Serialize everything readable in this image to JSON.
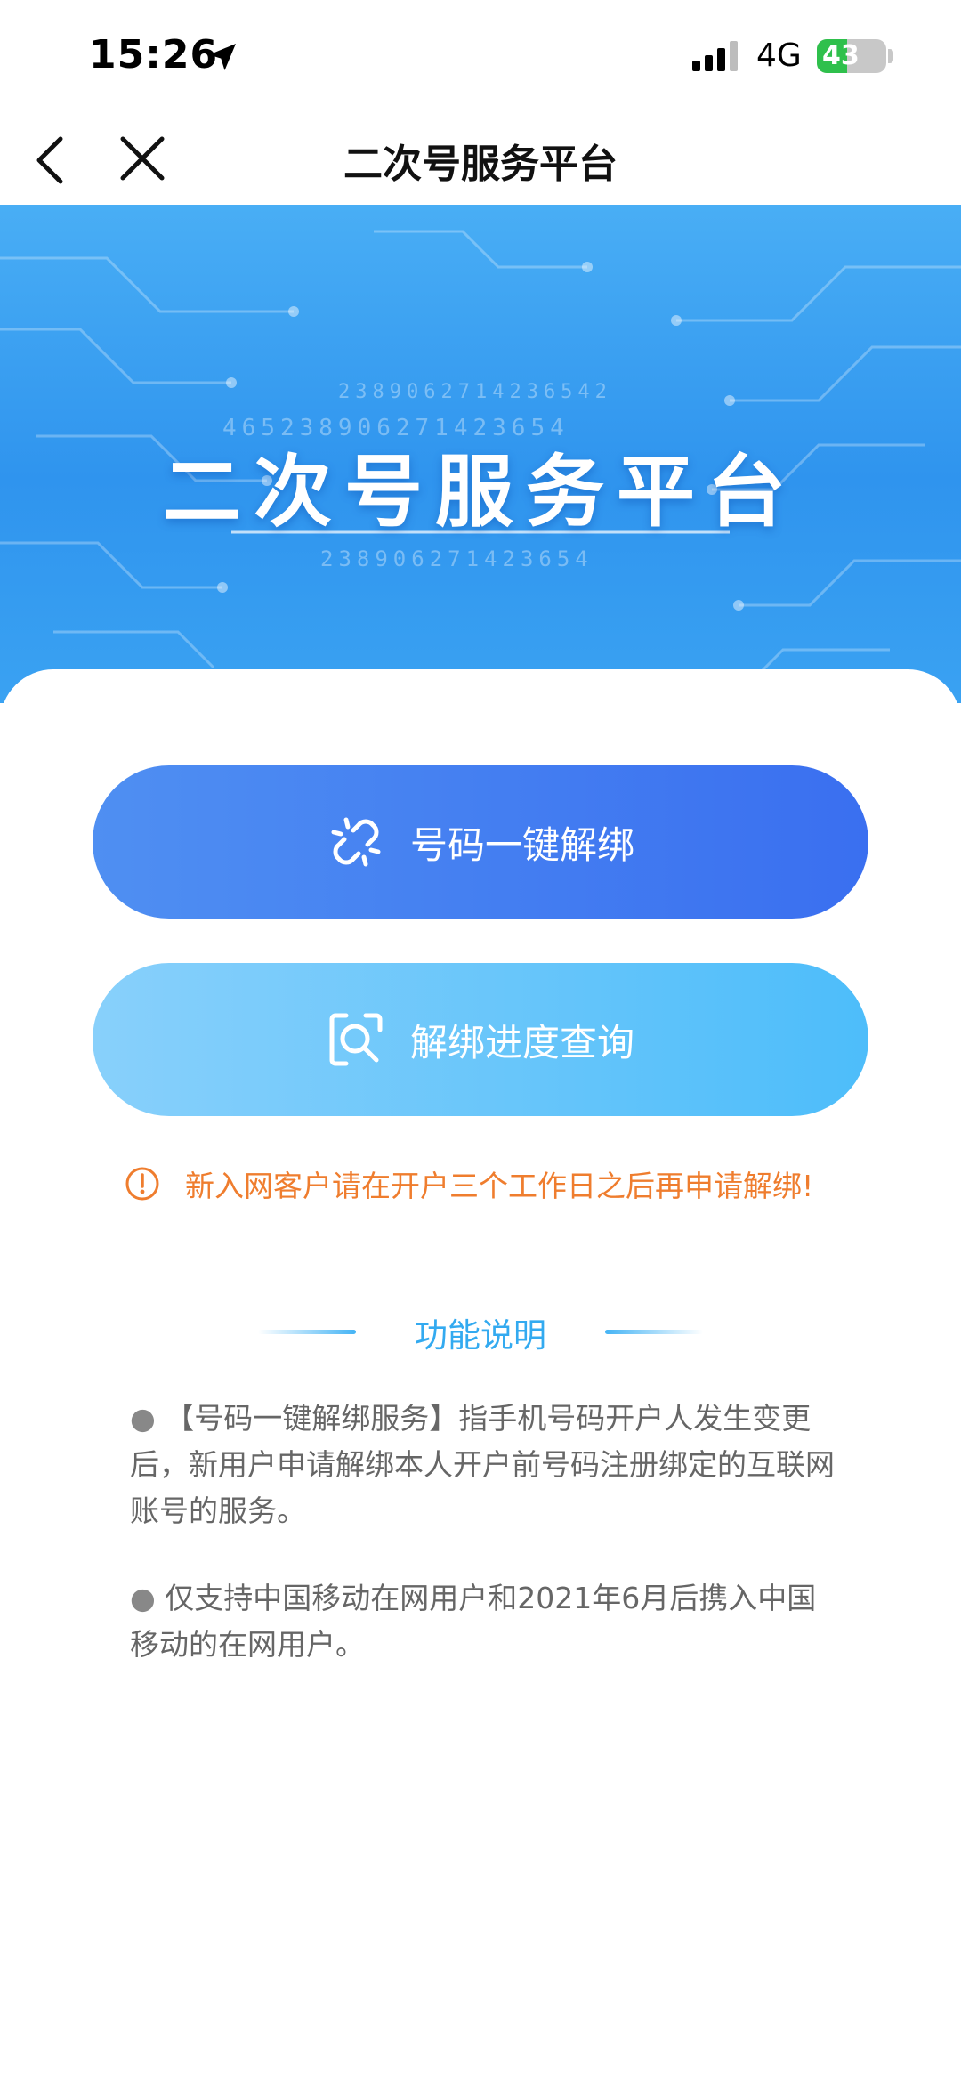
{
  "status": {
    "time": "15:26",
    "network": "4G",
    "battery": "43",
    "battery_level": 0.43,
    "location_icon": "location-arrow-icon",
    "signal_icon": "signal-bars-icon"
  },
  "nav": {
    "title": "二次号服务平台",
    "back_icon": "chevron-left-icon",
    "close_icon": "close-icon"
  },
  "banner": {
    "title": "二次号服务平台",
    "digits": [
      "2389062714236542",
      "465238906271423654",
      "238906271423654"
    ]
  },
  "actions": {
    "unbind_label": "号码一键解绑",
    "unbind_icon": "broken-link-icon",
    "query_label": "解绑进度查询",
    "query_icon": "magnifier-icon"
  },
  "notice": {
    "icon": "warning-circle-icon",
    "text": "新入网客户请在开户三个工作日之后再申请解绑!"
  },
  "section": {
    "title": "功能说明",
    "items": [
      "【号码一键解绑服务】指手机号码开户人发生变更后，新用户申请解绑本人开户前号码注册绑定的互联网账号的服务。",
      "仅支持中国移动在网用户和2021年6月后携入中国移动的在网用户。"
    ]
  },
  "colors": {
    "banner_blue": "#3a9ef2",
    "primary_blue": "#3a6ff0",
    "light_blue": "#4dbdfa",
    "warning_orange": "#ef7d2e",
    "section_blue": "#33aaf0"
  }
}
